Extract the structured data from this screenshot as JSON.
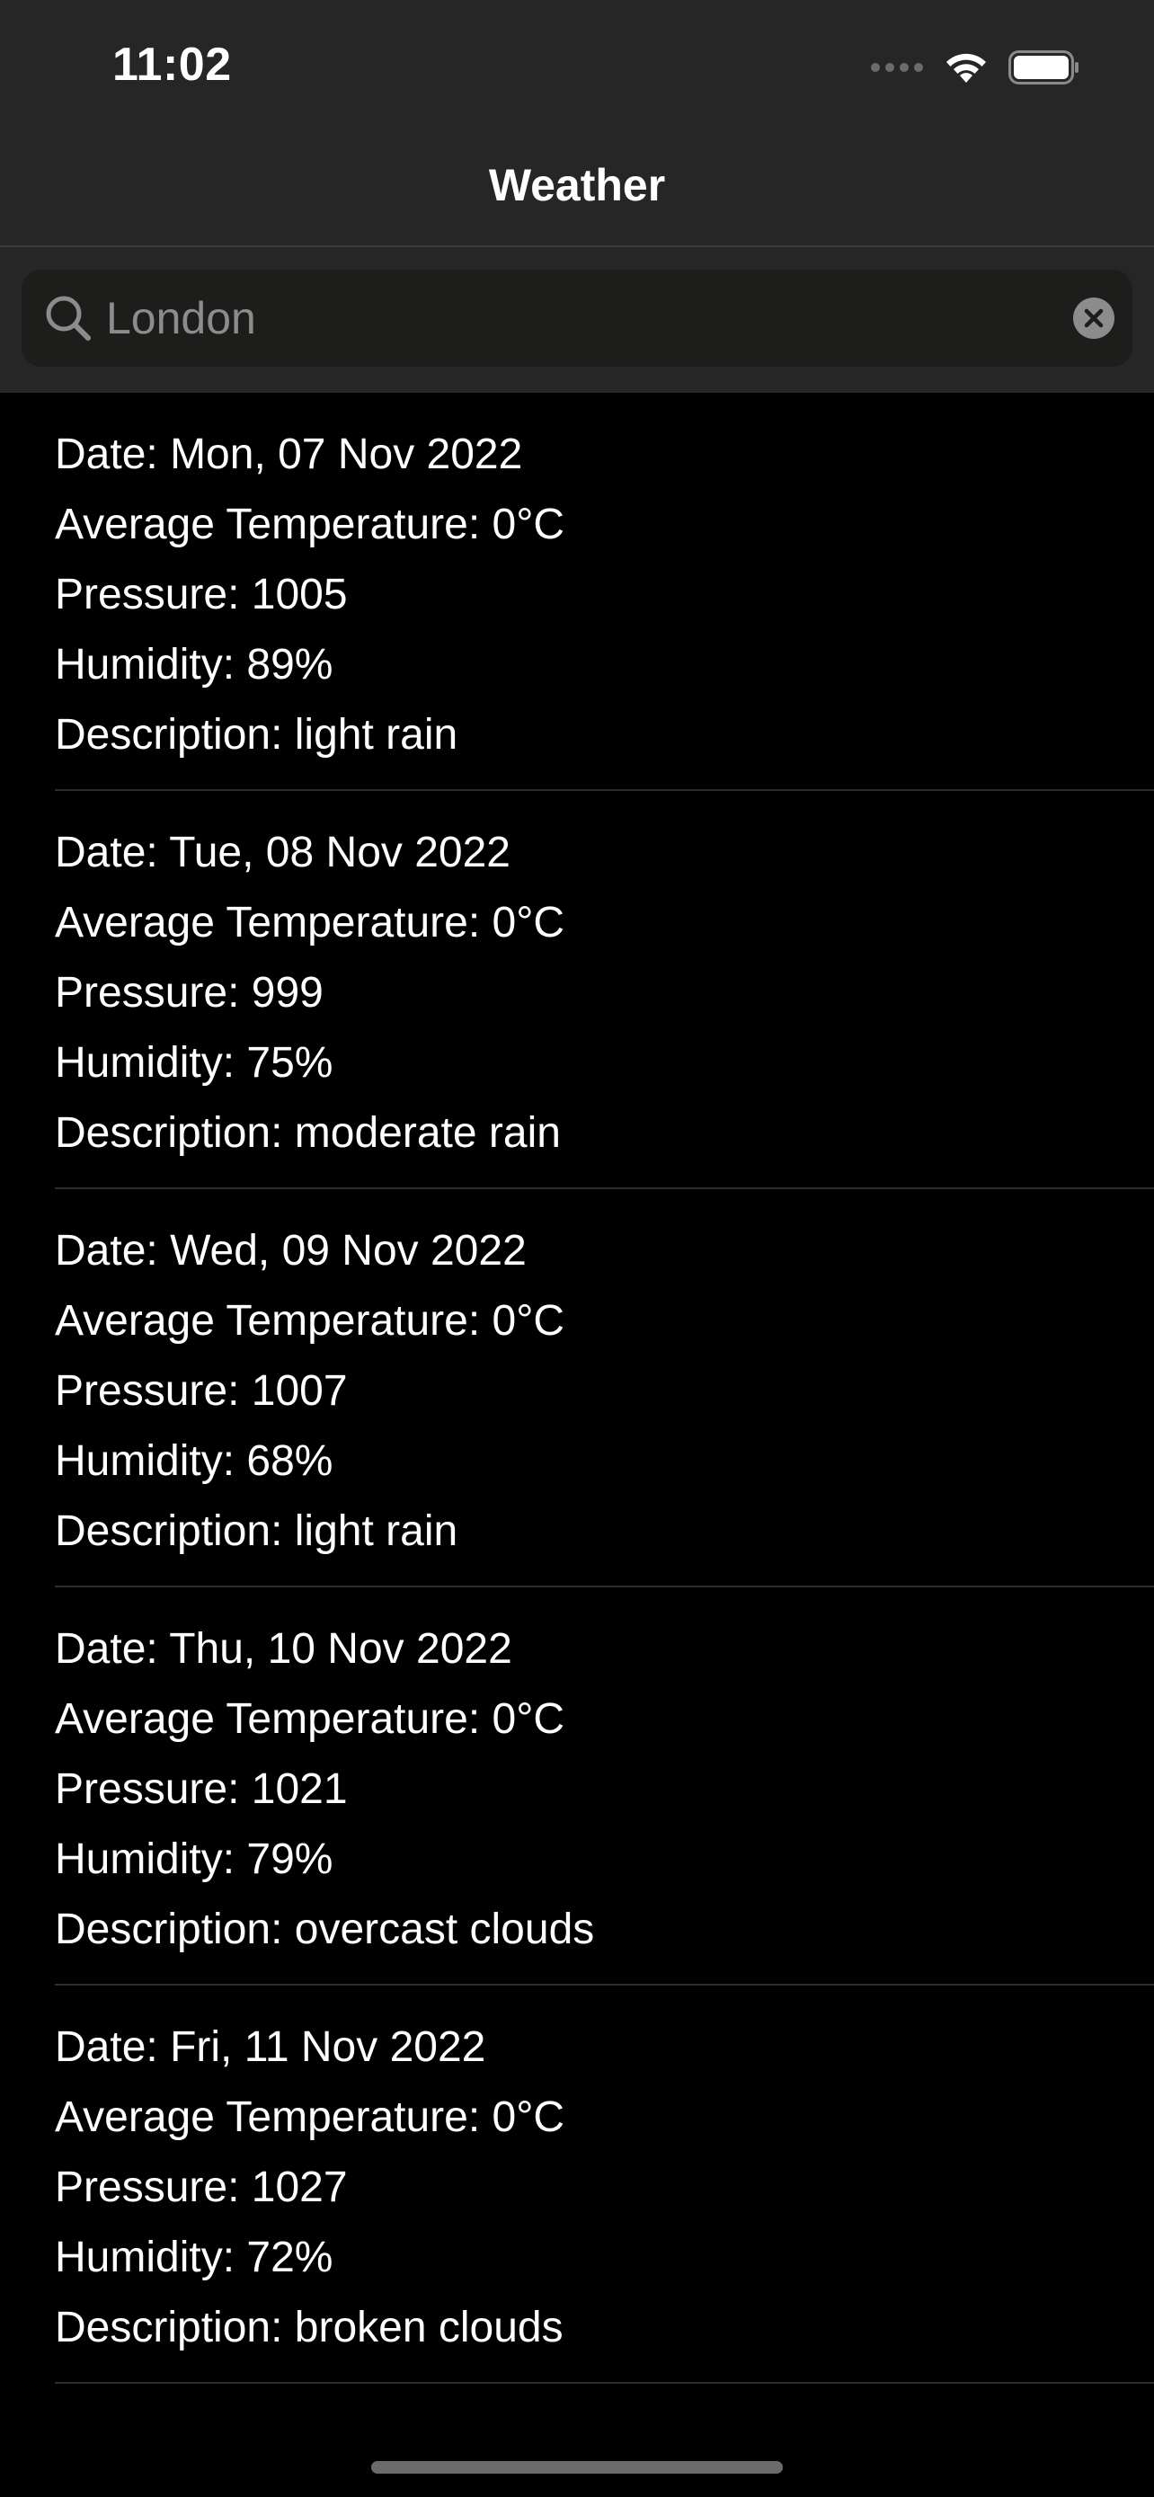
{
  "status_bar": {
    "time": "11:02",
    "icons": [
      "signal-dots-icon",
      "wifi-icon",
      "battery-icon"
    ]
  },
  "nav": {
    "title": "Weather"
  },
  "search": {
    "placeholder": "London",
    "value": "",
    "icon": "search-icon",
    "clear_icon": "clear-icon"
  },
  "forecast": [
    {
      "date": "Date: Mon, 07 Nov 2022",
      "avg_temp": "Average Temperature: 0°C",
      "pressure": "Pressure: 1005",
      "humidity": "Humidity: 89%",
      "description": "Description: light rain"
    },
    {
      "date": "Date: Tue, 08 Nov 2022",
      "avg_temp": "Average Temperature: 0°C",
      "pressure": "Pressure: 999",
      "humidity": "Humidity: 75%",
      "description": "Description: moderate rain"
    },
    {
      "date": "Date: Wed, 09 Nov 2022",
      "avg_temp": "Average Temperature: 0°C",
      "pressure": "Pressure: 1007",
      "humidity": "Humidity: 68%",
      "description": "Description: light rain"
    },
    {
      "date": "Date: Thu, 10 Nov 2022",
      "avg_temp": "Average Temperature: 0°C",
      "pressure": "Pressure: 1021",
      "humidity": "Humidity: 79%",
      "description": "Description: overcast clouds"
    },
    {
      "date": "Date: Fri, 11 Nov 2022",
      "avg_temp": "Average Temperature: 0°C",
      "pressure": "Pressure: 1027",
      "humidity": "Humidity: 72%",
      "description": "Description: broken clouds"
    }
  ],
  "colors": {
    "background": "#000000",
    "bar": "#262626",
    "search_field": "#1d1d1b",
    "placeholder": "#8c8c8c",
    "separator": "#2c2c2e",
    "text": "#ffffff"
  }
}
